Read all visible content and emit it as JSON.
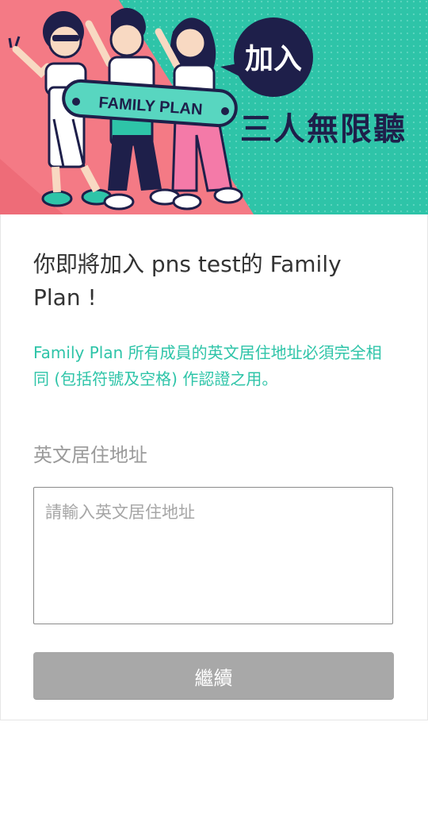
{
  "banner": {
    "skateboard_text": "FAMILY PLAN",
    "bubble_text": "加入",
    "slogan": "三人無限聽",
    "colors": {
      "left_bg": "#f47a85",
      "right_bg": "#2ec4a8",
      "accent": "#1e1f4a"
    }
  },
  "invite": {
    "headline": "你即將加入  pns test的 Family Plan !",
    "notice": "Family Plan 所有成員的英文居住地址必須完全相同 (包括符號及空格) 作認證之用。"
  },
  "address": {
    "label": "英文居住地址",
    "placeholder": "請輸入英文居住地址",
    "value": ""
  },
  "actions": {
    "continue_label": "繼續"
  }
}
